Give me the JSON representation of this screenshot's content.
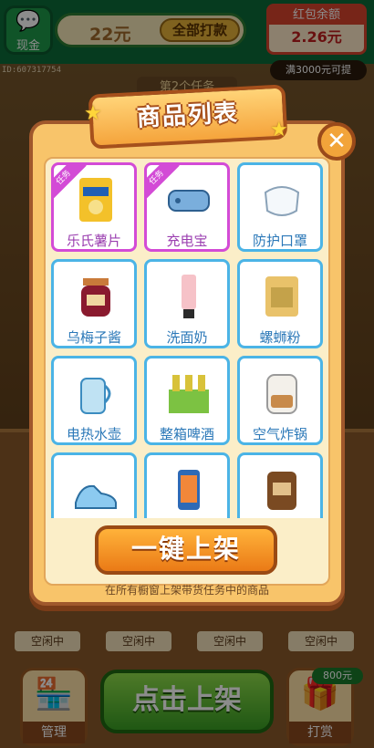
{
  "header": {
    "cash_label": "现金",
    "cash_amount": "22元",
    "withdraw_all": "全部打款",
    "red_envelope_label": "红包余额",
    "red_envelope_amount": "2.26元",
    "withdraw_threshold": "满3000元可提",
    "user_id": "ID:607317754",
    "task_tag": "第2个任务"
  },
  "modal": {
    "title": "商品列表",
    "close_icon": "close-icon",
    "task_badge": "任务",
    "products": [
      {
        "label": "乐氏薯片",
        "task": true,
        "icon": "chips-icon"
      },
      {
        "label": "充电宝",
        "task": true,
        "icon": "power-bank-icon"
      },
      {
        "label": "防护口罩",
        "task": false,
        "icon": "mask-icon"
      },
      {
        "label": "乌梅子酱",
        "task": false,
        "icon": "jam-jar-icon"
      },
      {
        "label": "洗面奶",
        "task": false,
        "icon": "cleanser-tube-icon"
      },
      {
        "label": "螺蛳粉",
        "task": false,
        "icon": "noodle-pack-icon"
      },
      {
        "label": "电热水壶",
        "task": false,
        "icon": "kettle-icon"
      },
      {
        "label": "整箱啤酒",
        "task": false,
        "icon": "beer-case-icon"
      },
      {
        "label": "空气炸锅",
        "task": false,
        "icon": "air-fryer-icon"
      },
      {
        "label": "",
        "task": false,
        "icon": "sneaker-icon"
      },
      {
        "label": "",
        "task": false,
        "icon": "phone-icon"
      },
      {
        "label": "",
        "task": false,
        "icon": "tea-tin-icon"
      }
    ],
    "one_click_button": "一键上架",
    "hint": "在所有橱窗上架带货任务中的商品"
  },
  "shelf": {
    "idle_label": "空闲中"
  },
  "bottom_bar": {
    "manage_label": "管理",
    "click_shelf": "点击上架",
    "reward_label": "打赏",
    "reward_badge": "800元"
  },
  "colors": {
    "task_border": "#d34bd6",
    "plain_border": "#4bb4e6",
    "accent_orange": "#ea7a16",
    "green": "#3aa024"
  }
}
